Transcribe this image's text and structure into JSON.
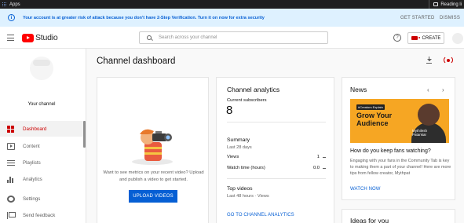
{
  "browser": {
    "apps_label": "Apps",
    "reading_list_label": "Reading li"
  },
  "banner": {
    "message": "Your account is at greater risk of attack because you don't have 2-Step Verification. Turn it on now for extra security",
    "get_started": "GET STARTED",
    "dismiss": "DISMISS"
  },
  "header": {
    "logo_text": "Studio",
    "search_placeholder": "Search across your channel",
    "help_icon_glyph": "?",
    "create_label": "CREATE"
  },
  "sidebar": {
    "your_channel": "Your channel",
    "items": [
      {
        "label": "Dashboard",
        "icon": "dashboard-icon",
        "active": true
      },
      {
        "label": "Content",
        "icon": "content-icon",
        "active": false
      },
      {
        "label": "Playlists",
        "icon": "playlists-icon",
        "active": false
      },
      {
        "label": "Analytics",
        "icon": "analytics-icon",
        "active": false
      },
      {
        "label": "Settings",
        "icon": "settings-icon",
        "active": false
      },
      {
        "label": "Send feedback",
        "icon": "feedback-icon",
        "active": false
      }
    ]
  },
  "main": {
    "title": "Channel dashboard"
  },
  "upload_card": {
    "prompt": "Want to see metrics on your recent video? Upload and publish a video to get started.",
    "button": "UPLOAD VIDEOS"
  },
  "analytics": {
    "title": "Channel analytics",
    "subscribers_label": "Current subscribers",
    "subscribers_value": "8",
    "summary_title": "Summary",
    "summary_period": "Last 28 days",
    "rows": [
      {
        "label": "Views",
        "value": "1"
      },
      {
        "label": "Watch time (hours)",
        "value": "0.0"
      }
    ],
    "top_videos_title": "Top videos",
    "top_videos_period": "Last 48 hours · Views",
    "link": "GO TO CHANNEL ANALYTICS"
  },
  "news": {
    "title": "News",
    "prev_glyph": "‹",
    "next_glyph": "›",
    "image_badge": "#Creators Explain",
    "image_headline_line1": "Grow Your",
    "image_headline_line2": "Audience",
    "image_person_name_line1": "Mythilesh",
    "image_person_name_line2": "Patankar",
    "headline": "How do you keep fans watching?",
    "body": "Engaging with your fans in the Community Tab is key to making them a part of your channel! Here are more tips from fellow creator, Mythpat",
    "link": "WATCH NOW"
  },
  "ideas": {
    "title": "Ideas for you"
  },
  "colors": {
    "brand_red": "#ff0000",
    "active_red": "#cc0000",
    "link_blue": "#065fd4",
    "banner_bg": "#def1ff",
    "news_image_bg": "#f6a623"
  }
}
